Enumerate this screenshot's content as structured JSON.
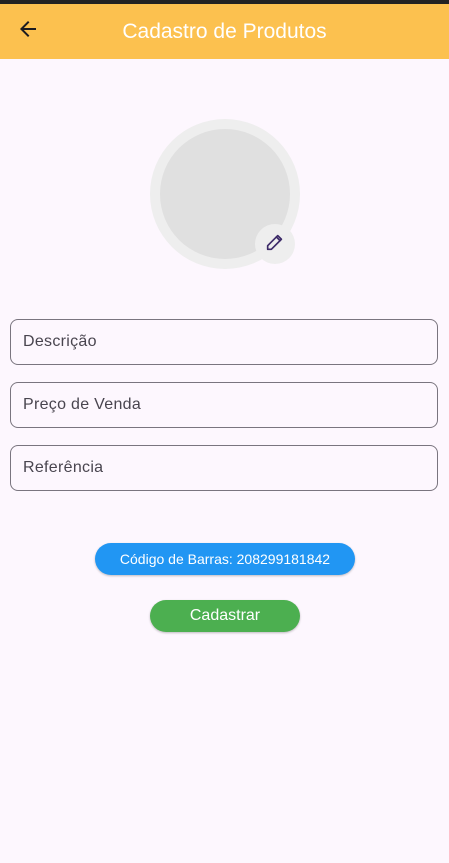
{
  "app_bar": {
    "title": "Cadastro de Produtos",
    "back_icon": "arrow-back-icon",
    "color": "#fcc14f"
  },
  "photo": {
    "edit_icon": "pencil-icon"
  },
  "form": {
    "fields": [
      {
        "placeholder": "Descrição",
        "value": ""
      },
      {
        "placeholder": "Preço de Venda",
        "value": ""
      },
      {
        "placeholder": "Referência",
        "value": ""
      }
    ]
  },
  "barcode_button": {
    "label": "Código de Barras: 208299181842",
    "color": "#2196f3"
  },
  "submit_button": {
    "label": "Cadastrar",
    "color": "#4caf50"
  }
}
